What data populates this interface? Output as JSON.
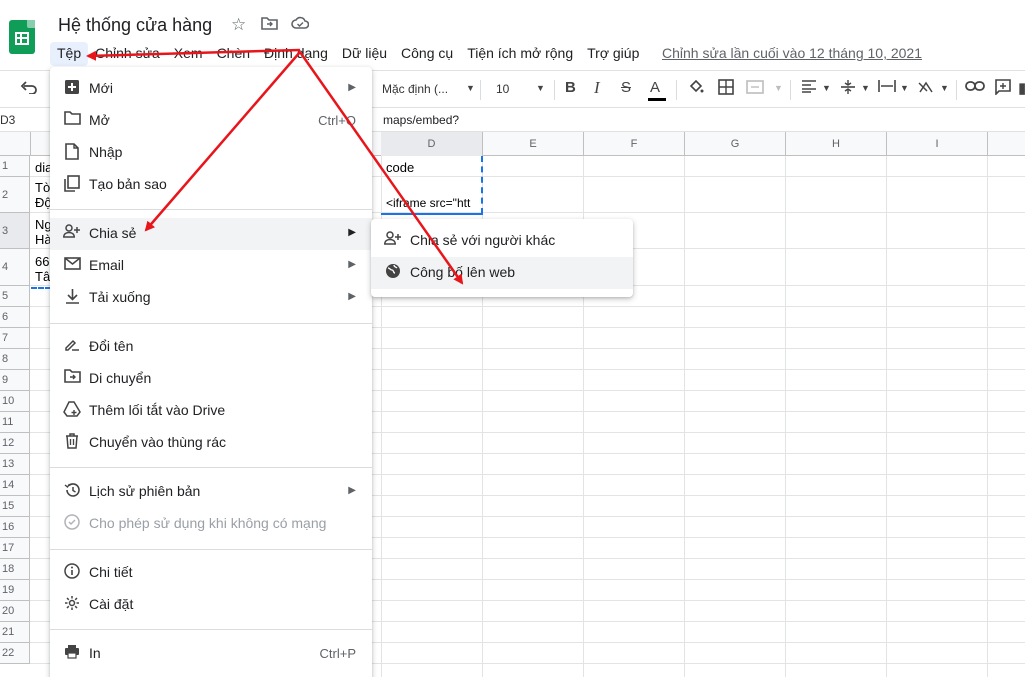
{
  "header": {
    "title": "Hệ thống cửa hàng",
    "menus": [
      "Tệp",
      "Chỉnh sửa",
      "Xem",
      "Chèn",
      "Định dạng",
      "Dữ liệu",
      "Công cụ",
      "Tiện ích mở rộng",
      "Trợ giúp"
    ],
    "active_menu_index": 0,
    "last_edit": "Chỉnh sửa lần cuối vào 12 tháng 10, 2021"
  },
  "toolbar": {
    "font": "Mặc định (...",
    "font_size": "10"
  },
  "formula_bar": {
    "cell_ref": "D3",
    "content": "maps/embed?"
  },
  "grid": {
    "columns": [
      "D",
      "E",
      "F",
      "G",
      "H",
      "I"
    ],
    "rows": [
      "1",
      "2",
      "3",
      "4",
      "5",
      "6",
      "7",
      "8",
      "9",
      "10",
      "11",
      "12",
      "13",
      "14",
      "15",
      "16",
      "17",
      "18",
      "19",
      "20",
      "21",
      "22"
    ],
    "cells": {
      "a1": "dia",
      "a2": "Tò",
      "a2b": "Độ",
      "a3": "Ng",
      "a3b": "Hà",
      "a4": "66",
      "a4b": "Tâ",
      "d1": "code",
      "d2": "<iframe src=\"htt"
    }
  },
  "file_menu": {
    "items": [
      {
        "label": "Mới",
        "icon": "new-icon",
        "submenu": true
      },
      {
        "label": "Mở",
        "icon": "folder-icon",
        "shortcut": "Ctrl+O"
      },
      {
        "label": "Nhập",
        "icon": "import-icon"
      },
      {
        "label": "Tạo bản sao",
        "icon": "copy-icon"
      },
      {
        "label": "Chia sẻ",
        "icon": "share-person-icon",
        "submenu": true
      },
      {
        "label": "Email",
        "icon": "email-icon",
        "submenu": true
      },
      {
        "label": "Tải xuống",
        "icon": "download-icon",
        "submenu": true
      },
      {
        "label": "Đổi tên",
        "icon": "rename-icon"
      },
      {
        "label": "Di chuyển",
        "icon": "move-icon"
      },
      {
        "label": "Thêm lối tắt vào Drive",
        "icon": "drive-shortcut-icon"
      },
      {
        "label": "Chuyển vào thùng rác",
        "icon": "trash-icon"
      },
      {
        "label": "Lịch sử phiên bản",
        "icon": "history-icon",
        "submenu": true
      },
      {
        "label": "Cho phép sử dụng khi không có mạng",
        "icon": "offline-icon",
        "disabled": true
      },
      {
        "label": "Chi tiết",
        "icon": "info-icon"
      },
      {
        "label": "Cài đặt",
        "icon": "settings-icon"
      },
      {
        "label": "In",
        "icon": "print-icon",
        "shortcut": "Ctrl+P"
      }
    ]
  },
  "share_menu": {
    "items": [
      {
        "label": "Chia sẻ với người khác",
        "icon": "share-person-icon"
      },
      {
        "label": "Công bố lên web",
        "icon": "globe-icon"
      }
    ]
  },
  "colors": {
    "accent": "#1a73e8",
    "sheets_green": "#0f9d58",
    "annotation_red": "#e8151b",
    "menu_hover": "#f1f3f4"
  }
}
